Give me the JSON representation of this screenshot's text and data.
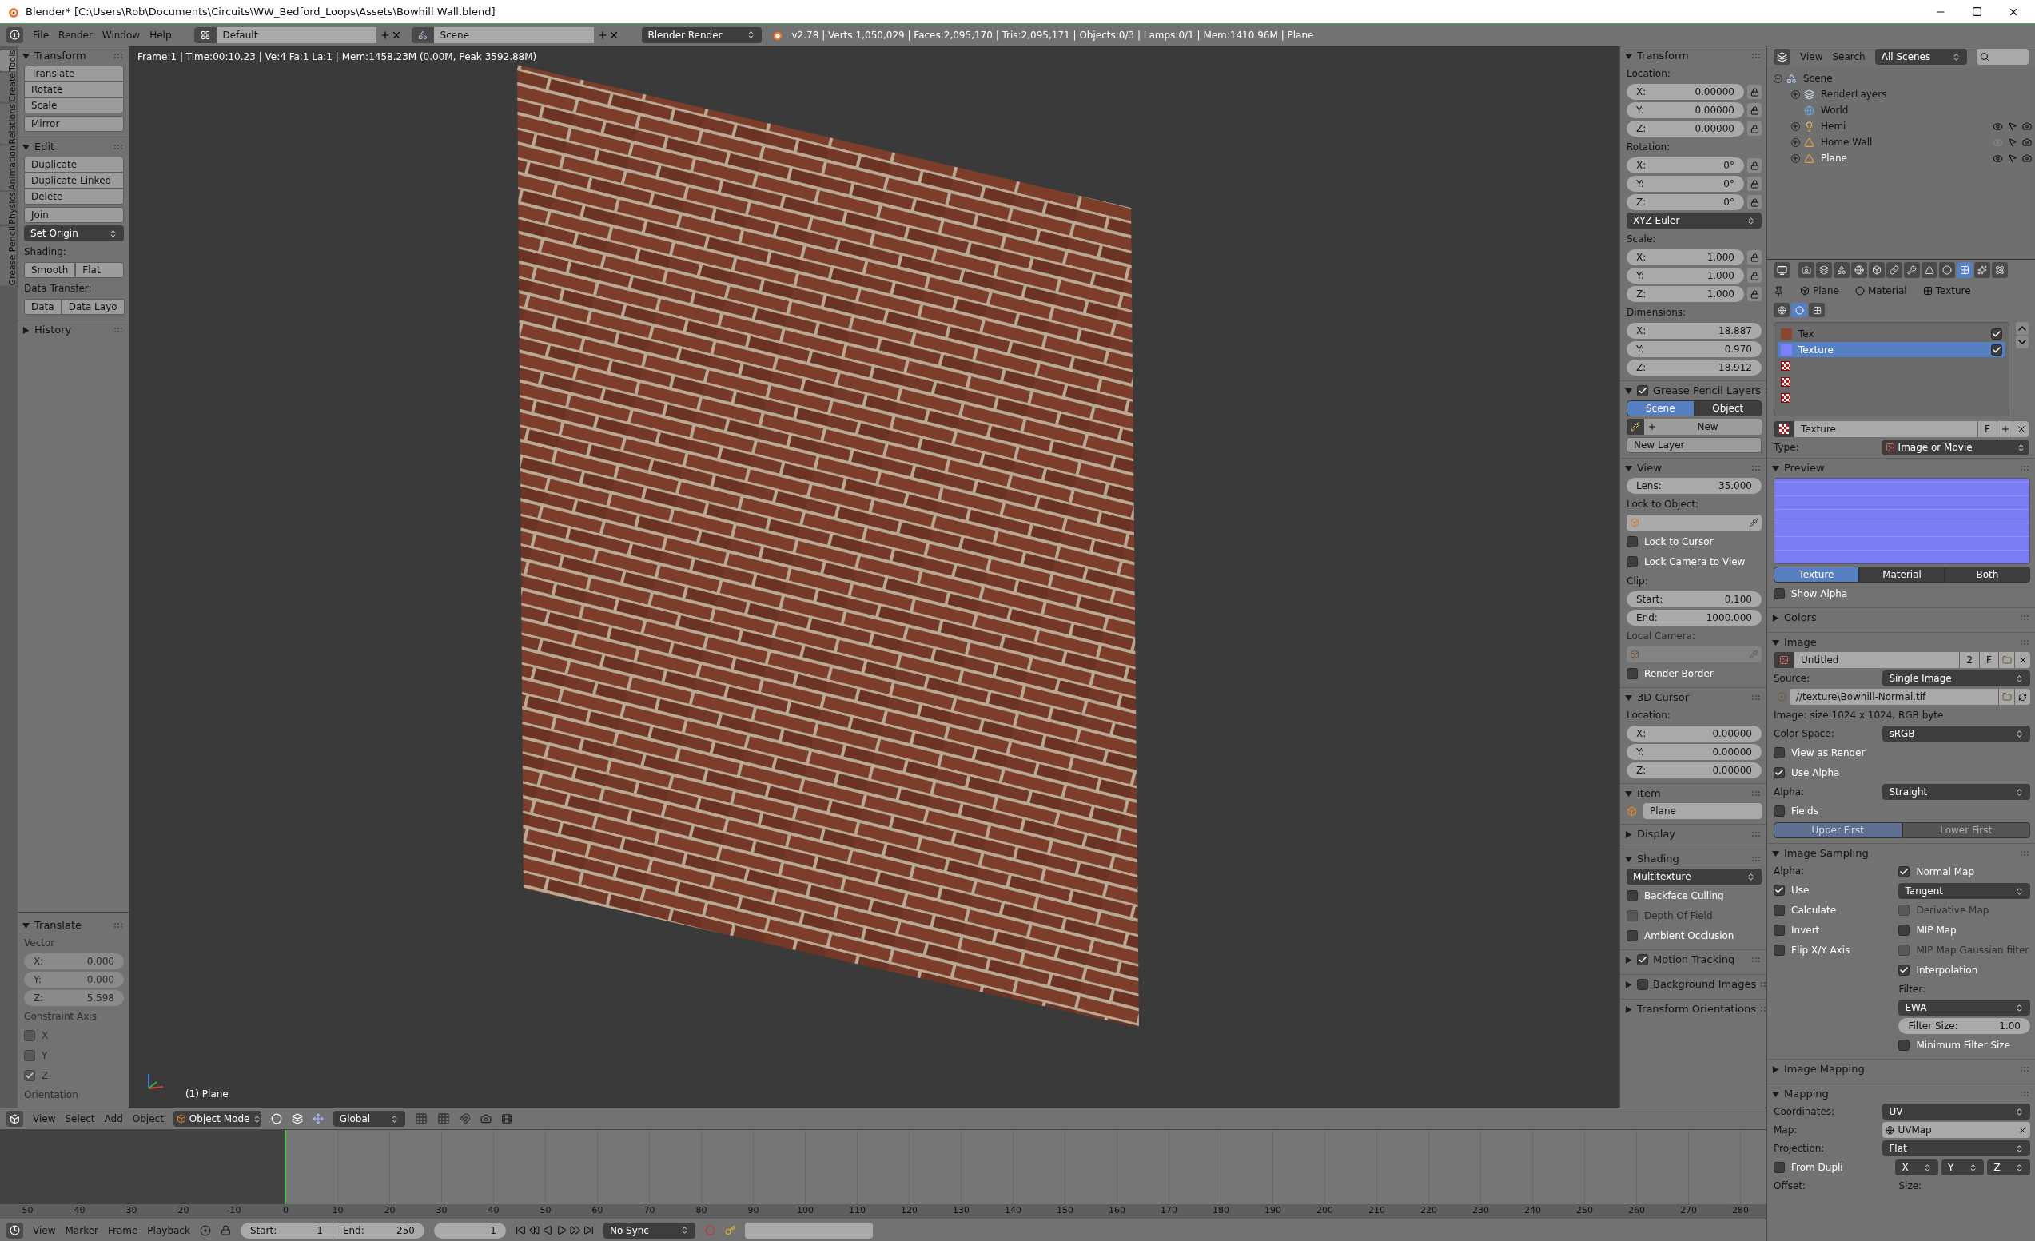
{
  "window": {
    "title": "Blender* [C:\\Users\\Rob\\Documents\\Circuits\\WW_Bedford_Loops\\Assets\\Bowhill Wall.blend]"
  },
  "info_header": {
    "menus": [
      "File",
      "Render",
      "Window",
      "Help"
    ],
    "layout": "Default",
    "scene": "Scene",
    "engine": "Blender Render",
    "stats": "v2.78 | Verts:1,050,029 | Faces:2,095,170 | Tris:2,095,171 | Objects:0/3 | Lamps:0/1 | Mem:1410.96M | Plane"
  },
  "tool_tabs": [
    {
      "label": "Tools",
      "selected": true
    },
    {
      "label": "Create",
      "selected": false
    },
    {
      "label": "Relations",
      "selected": false
    },
    {
      "label": "Animation",
      "selected": false
    },
    {
      "label": "Physics",
      "selected": false
    },
    {
      "label": "Grease Pencil",
      "selected": false
    }
  ],
  "tool_panels": [
    {
      "title": "Transform",
      "expanded": true,
      "rows": [
        {
          "kind": "buttons",
          "labels": [
            "Translate",
            "Rotate",
            "Scale"
          ]
        },
        {
          "kind": "buttons",
          "labels": [
            "Mirror"
          ]
        }
      ]
    },
    {
      "title": "Edit",
      "expanded": true,
      "rows": [
        {
          "kind": "buttons",
          "labels": [
            "Duplicate",
            "Duplicate Linked",
            "Delete"
          ]
        },
        {
          "kind": "buttons",
          "labels": [
            "Join"
          ]
        },
        {
          "kind": "dropdown",
          "value": "Set Origin"
        },
        {
          "kind": "label",
          "text": "Shading:"
        },
        {
          "kind": "hbuttons",
          "labels": [
            "Smooth",
            "Flat"
          ]
        },
        {
          "kind": "label",
          "text": "Data Transfer:"
        },
        {
          "kind": "hbuttons",
          "labels": [
            "Data",
            "Data Layo"
          ]
        }
      ]
    },
    {
      "title": "History",
      "expanded": false
    }
  ],
  "redo_panel": {
    "title": "Translate",
    "expanded": true,
    "rows": [
      {
        "kind": "label",
        "text": "Vector",
        "disabled": true
      },
      {
        "kind": "number",
        "label": "X:",
        "value": "0.000",
        "disabled": true
      },
      {
        "kind": "number",
        "label": "Y:",
        "value": "0.000",
        "disabled": true
      },
      {
        "kind": "number",
        "label": "Z:",
        "value": "5.598",
        "disabled": true
      },
      {
        "kind": "label",
        "text": "Constraint Axis",
        "disabled": true
      },
      {
        "kind": "checkbox",
        "label": "X",
        "checked": false,
        "disabled": true
      },
      {
        "kind": "checkbox",
        "label": "Y",
        "checked": false,
        "disabled": true
      },
      {
        "kind": "checkbox",
        "label": "Z",
        "checked": true,
        "disabled": true
      },
      {
        "kind": "label",
        "text": "Orientation",
        "disabled": true
      }
    ]
  },
  "viewport": {
    "frame_info": "Frame:1 | Time:00:10.23 | Ve:4 Fa:1 La:1 | Mem:1458.23M (0.00M, Peak 3592.88M)",
    "object_label": "(1) Plane"
  },
  "n_panels": [
    {
      "title": "Transform",
      "expanded": true,
      "rows": [
        {
          "kind": "label",
          "text": "Location:"
        },
        {
          "kind": "number",
          "label": "X:",
          "value": "0.00000",
          "lock": true
        },
        {
          "kind": "number",
          "label": "Y:",
          "value": "0.00000",
          "lock": true
        },
        {
          "kind": "number",
          "label": "Z:",
          "value": "0.00000",
          "lock": true
        },
        {
          "kind": "label",
          "text": "Rotation:"
        },
        {
          "kind": "number",
          "label": "X:",
          "value": "0°",
          "lock": true
        },
        {
          "kind": "number",
          "label": "Y:",
          "value": "0°",
          "lock": true
        },
        {
          "kind": "number",
          "label": "Z:",
          "value": "0°",
          "lock": true
        },
        {
          "kind": "dropdown",
          "value": "XYZ Euler"
        },
        {
          "kind": "label",
          "text": "Scale:"
        },
        {
          "kind": "number",
          "label": "X:",
          "value": "1.000",
          "lock": true
        },
        {
          "kind": "number",
          "label": "Y:",
          "value": "1.000",
          "lock": true
        },
        {
          "kind": "number",
          "label": "Z:",
          "value": "1.000",
          "lock": true
        },
        {
          "kind": "label",
          "text": "Dimensions:"
        },
        {
          "kind": "number",
          "label": "X:",
          "value": "18.887"
        },
        {
          "kind": "number",
          "label": "Y:",
          "value": "0.970"
        },
        {
          "kind": "number",
          "label": "Z:",
          "value": "18.912"
        }
      ]
    },
    {
      "title": "Grease Pencil Layers",
      "expanded": true,
      "checked": true,
      "rows": [
        {
          "kind": "toggle",
          "options": [
            {
              "label": "Scene",
              "selected": true
            },
            {
              "label": "Object",
              "selected": false
            }
          ]
        },
        {
          "kind": "new_button",
          "label": "New"
        },
        {
          "kind": "buttons",
          "labels": [
            "New Layer"
          ]
        }
      ]
    },
    {
      "title": "View",
      "expanded": true,
      "rows": [
        {
          "kind": "number",
          "label": "Lens:",
          "value": "35.000"
        },
        {
          "kind": "label",
          "text": "Lock to Object:"
        },
        {
          "kind": "object_field",
          "disabled": false
        },
        {
          "kind": "checkbox",
          "label": "Lock to Cursor",
          "checked": false
        },
        {
          "kind": "checkbox",
          "label": "Lock Camera to View",
          "checked": false
        },
        {
          "kind": "label",
          "text": "Clip:"
        },
        {
          "kind": "number",
          "label": "Start:",
          "value": "0.100"
        },
        {
          "kind": "number",
          "label": "End:",
          "value": "1000.000"
        },
        {
          "kind": "label",
          "text": "Local Camera:",
          "disabled": true
        },
        {
          "kind": "object_field",
          "disabled": true
        },
        {
          "kind": "checkbox",
          "label": "Render Border",
          "checked": false
        }
      ]
    },
    {
      "title": "3D Cursor",
      "expanded": true,
      "rows": [
        {
          "kind": "label",
          "text": "Location:"
        },
        {
          "kind": "number",
          "label": "X:",
          "value": "0.00000"
        },
        {
          "kind": "number",
          "label": "Y:",
          "value": "0.00000"
        },
        {
          "kind": "number",
          "label": "Z:",
          "value": "0.00000"
        }
      ]
    },
    {
      "title": "Item",
      "expanded": true,
      "rows": [
        {
          "kind": "item_field",
          "value": "Plane"
        }
      ]
    },
    {
      "title": "Display",
      "expanded": false
    },
    {
      "title": "Shading",
      "expanded": true,
      "rows": [
        {
          "kind": "dropdown",
          "value": "Multitexture"
        },
        {
          "kind": "checkbox",
          "label": "Backface Culling",
          "checked": false
        },
        {
          "kind": "checkbox",
          "label": "Depth Of Field",
          "checked": false,
          "disabled": true
        },
        {
          "kind": "checkbox",
          "label": "Ambient Occlusion",
          "checked": false
        }
      ]
    },
    {
      "title": "Motion Tracking",
      "expanded": false,
      "checked": true
    },
    {
      "title": "Background Images",
      "expanded": false,
      "checked": false
    },
    {
      "title": "Transform Orientations",
      "expanded": false
    }
  ],
  "view3d_header": {
    "menus": [
      "View",
      "Select",
      "Add",
      "Object"
    ],
    "mode": "Object Mode",
    "orientation": "Global"
  },
  "timeline": {
    "ruler": [
      "-50",
      "-40",
      "-30",
      "-20",
      "-10",
      "0",
      "10",
      "20",
      "30",
      "40",
      "50",
      "60",
      "70",
      "80",
      "90",
      "100",
      "110",
      "120",
      "130",
      "140",
      "150",
      "160",
      "170",
      "180",
      "190",
      "200",
      "210",
      "220",
      "230",
      "240",
      "250",
      "260",
      "270",
      "280"
    ],
    "menus": [
      "View",
      "Marker",
      "Frame",
      "Playback"
    ],
    "start_label": "Start:",
    "start": "1",
    "end_label": "End:",
    "end": "250",
    "current": "1",
    "sync": "No Sync"
  },
  "outliner": {
    "menus": [
      "View",
      "Search"
    ],
    "filter": "All Scenes",
    "tree": [
      {
        "name": "Scene",
        "kind": "scene",
        "expanded": true,
        "children": [
          {
            "name": "RenderLayers",
            "kind": "renderlayers",
            "expanded": false
          },
          {
            "name": "World",
            "kind": "world"
          },
          {
            "name": "Hemi",
            "kind": "lamp",
            "expanded": false,
            "visible": true,
            "selected": false
          },
          {
            "name": "Home Wall",
            "kind": "mesh",
            "expanded": false,
            "visible": false,
            "selected": false
          },
          {
            "name": "Plane",
            "kind": "mesh",
            "expanded": false,
            "visible": true,
            "selected": true
          }
        ]
      }
    ]
  },
  "properties": {
    "context_tabs": [
      {
        "kind": "render",
        "selected": false
      },
      {
        "kind": "render_layers",
        "selected": false
      },
      {
        "kind": "scene",
        "selected": false
      },
      {
        "kind": "world",
        "selected": false
      },
      {
        "kind": "object",
        "selected": false
      },
      {
        "kind": "constraints",
        "selected": false
      },
      {
        "kind": "modifiers",
        "selected": false
      },
      {
        "kind": "data",
        "selected": false
      },
      {
        "kind": "material",
        "selected": false
      },
      {
        "kind": "texture",
        "selected": true
      },
      {
        "kind": "particles",
        "selected": false
      },
      {
        "kind": "physics",
        "selected": false
      }
    ],
    "breadcrumb": [
      {
        "kind": "object",
        "label": "Plane"
      },
      {
        "kind": "material",
        "label": "Material"
      },
      {
        "kind": "texture",
        "label": "Texture"
      }
    ],
    "texture_context": [
      {
        "kind": "world",
        "selected": false
      },
      {
        "kind": "material",
        "selected": true
      },
      {
        "kind": "texture",
        "selected": false
      }
    ],
    "slots": [
      {
        "kind": "image",
        "name": "Tex",
        "checked": true,
        "selected": false
      },
      {
        "kind": "color",
        "name": "Texture",
        "checked": true,
        "selected": true
      },
      {
        "kind": "empty",
        "selected": false
      },
      {
        "kind": "empty",
        "selected": false
      },
      {
        "kind": "empty",
        "selected": false
      }
    ],
    "datablock": {
      "name": "Texture",
      "fake": "F"
    },
    "type": {
      "label": "Type:",
      "value": "Image or Movie"
    },
    "panels": [
      {
        "title": "Preview",
        "expanded": true,
        "rows": [
          {
            "kind": "preview"
          },
          {
            "kind": "toggle",
            "options": [
              {
                "label": "Texture",
                "selected": true
              },
              {
                "label": "Material",
                "selected": false
              },
              {
                "label": "Both",
                "selected": false
              }
            ]
          },
          {
            "kind": "checkbox",
            "label": "Show Alpha",
            "checked": false
          }
        ]
      },
      {
        "title": "Colors",
        "expanded": false
      },
      {
        "title": "Image",
        "expanded": true,
        "rows": [
          {
            "kind": "datablock",
            "value": "Untitled",
            "users": "2",
            "fake": "F"
          },
          {
            "kind": "dropdown",
            "label": "Source:",
            "value": "Single Image"
          },
          {
            "kind": "path",
            "value": "//texture\\Bowhill-Normal.tif"
          },
          {
            "kind": "label",
            "text": "Image: size 1024 x 1024, RGB byte"
          },
          {
            "kind": "dropdown",
            "label": "Color Space:",
            "value": "sRGB"
          },
          {
            "kind": "checkbox",
            "label": "View as Render",
            "checked": false
          },
          {
            "kind": "checkbox",
            "label": "Use Alpha",
            "checked": true
          },
          {
            "kind": "dropdown",
            "label": "Alpha:",
            "value": "Straight"
          },
          {
            "kind": "checkbox",
            "label": "Fields",
            "checked": false
          },
          {
            "kind": "toggle",
            "disabled": true,
            "options": [
              {
                "label": "Upper First",
                "selected": true
              },
              {
                "label": "Lower First",
                "selected": false
              }
            ]
          }
        ]
      },
      {
        "title": "Image Sampling",
        "expanded": true,
        "rows": [
          {
            "kind": "columns",
            "left": [
              {
                "kind": "label",
                "text": "Alpha:"
              },
              {
                "kind": "checkbox",
                "label": "Use",
                "checked": true
              },
              {
                "kind": "checkbox",
                "label": "Calculate",
                "checked": false
              },
              {
                "kind": "checkbox",
                "label": "Invert",
                "checked": false
              },
              {
                "kind": "checkbox",
                "label": "Flip X/Y Axis",
                "checked": false
              }
            ],
            "right": [
              {
                "kind": "checkbox",
                "label": "Normal Map",
                "checked": true
              },
              {
                "kind": "dropdown",
                "value": "Tangent"
              },
              {
                "kind": "checkbox",
                "label": "Derivative Map",
                "checked": false,
                "disabled": true
              },
              {
                "kind": "checkbox",
                "label": "MIP Map",
                "checked": false
              },
              {
                "kind": "checkbox",
                "label": "MIP Map Gaussian filter",
                "checked": false,
                "disabled": true
              },
              {
                "kind": "checkbox",
                "label": "Interpolation",
                "checked": true
              },
              {
                "kind": "label",
                "text": "Filter:"
              },
              {
                "kind": "dropdown",
                "value": "EWA"
              },
              {
                "kind": "number",
                "label": "Filter Size:",
                "value": "1.00"
              },
              {
                "kind": "checkbox",
                "label": "Minimum Filter Size",
                "checked": false
              }
            ]
          }
        ]
      },
      {
        "title": "Image Mapping",
        "expanded": false
      },
      {
        "title": "Mapping",
        "expanded": true,
        "rows": [
          {
            "kind": "dropdown",
            "label": "Coordinates:",
            "value": "UV"
          },
          {
            "kind": "search_field",
            "label": "Map:",
            "value": "UVMap"
          },
          {
            "kind": "dropdown",
            "label": "Projection:",
            "value": "Flat"
          },
          {
            "kind": "dupli",
            "label": "From Dupli",
            "checked": false,
            "axes": [
              "X",
              "Y",
              "Z"
            ]
          },
          {
            "kind": "labels",
            "texts": [
              "Offset:",
              "Size:"
            ]
          }
        ]
      }
    ]
  }
}
